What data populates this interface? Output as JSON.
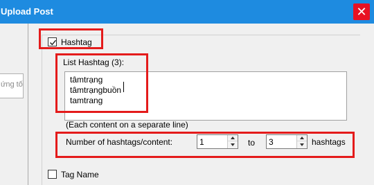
{
  "window": {
    "title": "Upload Post",
    "close_glyph": "✕"
  },
  "left_panel": {
    "input_fragment": "ứng tố"
  },
  "hashtag": {
    "checkbox_label": "Hashtag",
    "checked": true,
    "list_label": "List Hashtag (3):",
    "lines": [
      "tâmtrạng",
      "tâmtrạngbuồn",
      "tamtrang"
    ],
    "hint": "(Each content on a separate line)",
    "count_label": "Number of hashtags/content:",
    "min_value": "1",
    "to_label": "to",
    "max_value": "3",
    "unit_label": "hashtags"
  },
  "tag_name": {
    "checkbox_label": "Tag Name",
    "checked": false
  },
  "colors": {
    "titlebar": "#1e8be0",
    "close": "#e81123",
    "highlight": "#e41b1b"
  }
}
